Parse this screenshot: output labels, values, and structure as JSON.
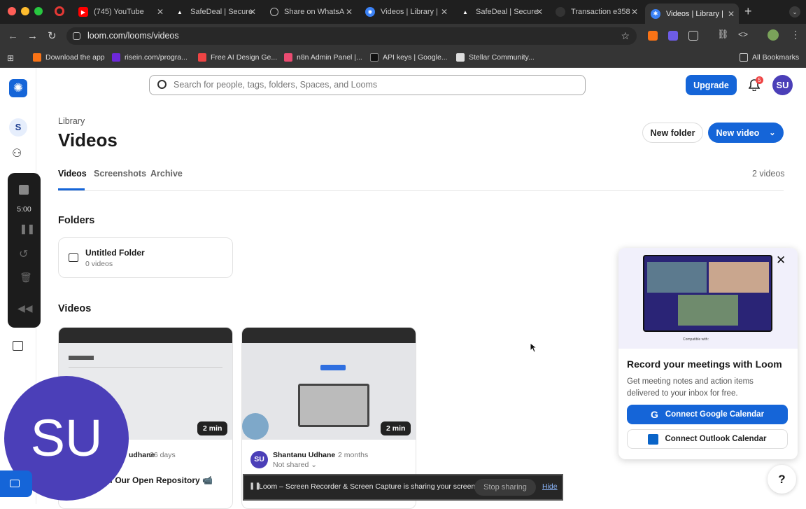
{
  "browser": {
    "tabs": [
      {
        "label": "(745) YouTube",
        "icon": "youtube-icon",
        "color": "#ff0000"
      },
      {
        "label": "SafeDeal | Secure",
        "icon": "safedeal-icon",
        "color": "#000000"
      },
      {
        "label": "Share on WhatsA",
        "icon": "globe-icon",
        "color": "#888888"
      },
      {
        "label": "Videos | Library |",
        "icon": "loom-icon",
        "color": "#3b82f6"
      },
      {
        "label": "SafeDeal | Secure",
        "icon": "safedeal-icon",
        "color": "#000000"
      },
      {
        "label": "Transaction e358",
        "icon": "transaction-icon",
        "color": "#333333"
      },
      {
        "label": "Videos | Library |",
        "icon": "loom-icon",
        "color": "#3b82f6"
      }
    ],
    "url": "loom.com/looms/videos",
    "bookmarks": [
      {
        "label": "Download the app",
        "color": "#f97316"
      },
      {
        "label": "risein.com/progra...",
        "color": "#6d28d9"
      },
      {
        "label": "Free AI Design Ge...",
        "color": "#ef4444"
      },
      {
        "label": "n8n Admin Panel |...",
        "color": "#ea4b71"
      },
      {
        "label": "API keys | Google...",
        "color": "#111111"
      },
      {
        "label": "Stellar Community...",
        "color": "#dddddd"
      }
    ],
    "all_bookmarks": "All Bookmarks"
  },
  "header": {
    "search_placeholder": "Search for people, tags, folders, Spaces, and Looms",
    "upgrade": "Upgrade",
    "notifications": "5",
    "avatar": "SU"
  },
  "sidebar": {
    "workspace": "S",
    "timer": "5:00"
  },
  "page": {
    "breadcrumb": "Library",
    "title": "Videos",
    "new_folder": "New folder",
    "new_video": "New video",
    "tabs": [
      "Videos",
      "Screenshots",
      "Archive"
    ],
    "count": "2 videos",
    "folders_heading": "Folders",
    "folder": {
      "name": "Untitled Folder",
      "count": "0 videos"
    },
    "videos_heading": "Videos",
    "videos": [
      {
        "duration": "2 min",
        "author": "udhane",
        "age": "26 days",
        "title": "f Our Open Repository 📹"
      },
      {
        "duration": "2 min",
        "author": "Shantanu Udhane",
        "age": "2 months",
        "status": "Not shared",
        "avatar": "SU"
      }
    ]
  },
  "promo": {
    "compatible": "Compatible with:",
    "title": "Record your meetings with Loom",
    "body": "Get meeting notes and action items delivered to your inbox for free.",
    "google": "Connect Google Calendar",
    "outlook": "Connect Outlook Calendar"
  },
  "camera_bubble": "SU",
  "share_bar": {
    "message": "Loom – Screen Recorder & Screen Capture is sharing your screen.",
    "stop": "Stop sharing",
    "hide": "Hide"
  },
  "help": "?",
  "colors": {
    "brand": "#1565d8",
    "badge": "#ef4444",
    "avatar": "#4b3fb8"
  }
}
